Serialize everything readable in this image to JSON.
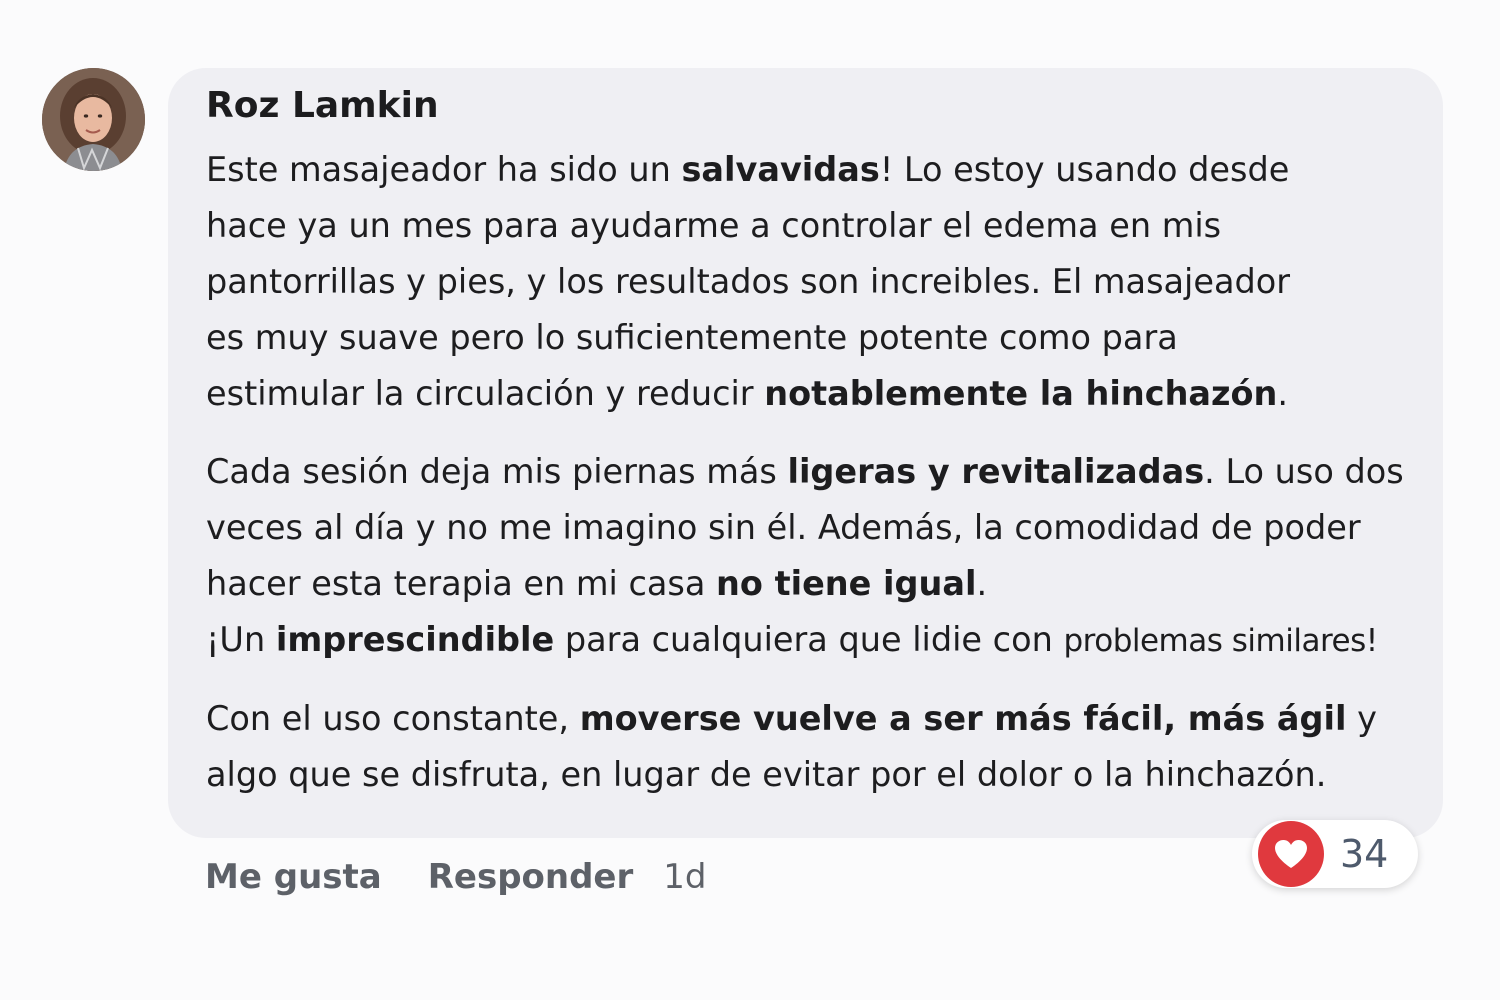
{
  "comment": {
    "author": "Roz Lamkin",
    "avatar_icon": "user-avatar-photo",
    "paragraphs": [
      {
        "lines": [
          [
            {
              "t": "Este masajeador ha sido un "
            },
            {
              "t": "salvavidas",
              "b": true
            },
            {
              "t": "! Lo estoy usando desde"
            }
          ],
          [
            {
              "t": "hace ya un mes para ayudarme a controlar el edema en mis"
            }
          ],
          [
            {
              "t": "pantorrillas y pies, y los resultados son increibles. El masajeador"
            }
          ],
          [
            {
              "t": "es muy suave pero lo suficientemente potente como para"
            }
          ],
          [
            {
              "t": "estimular la circulación y reducir "
            },
            {
              "t": "notablemente la hinchazón",
              "b": true
            },
            {
              "t": "."
            }
          ]
        ]
      },
      {
        "lines": [
          [
            {
              "t": "Cada sesión deja mis piernas más "
            },
            {
              "t": "ligeras y revitalizadas",
              "b": true
            },
            {
              "t": ". Lo uso dos"
            }
          ],
          [
            {
              "t": "veces al día y no me imagino sin él. Además, la comodidad de poder"
            }
          ],
          [
            {
              "t": "hacer esta terapia en mi casa "
            },
            {
              "t": "no tiene igual",
              "b": true
            },
            {
              "t": "."
            }
          ],
          [
            {
              "t": "¡Un "
            },
            {
              "t": "imprescindible",
              "b": true
            },
            {
              "t": " para cualquiera que lidie con "
            },
            {
              "t": "problemas similares!",
              "small": true
            }
          ]
        ]
      },
      {
        "lines": [
          [
            {
              "t": "Con el uso constante, "
            },
            {
              "t": "moverse vuelve a ser más fácil, más ágil",
              "b": true
            },
            {
              "t": " y"
            }
          ],
          [
            {
              "t": "algo que se disfruta, en lugar de evitar por el dolor o la hinchazón."
            }
          ]
        ]
      }
    ]
  },
  "actions": {
    "like_label": "Me gusta",
    "reply_label": "Responder",
    "timestamp": "1d"
  },
  "reactions": {
    "icon": "heart-icon",
    "color": "#e0393e",
    "count": "34"
  }
}
